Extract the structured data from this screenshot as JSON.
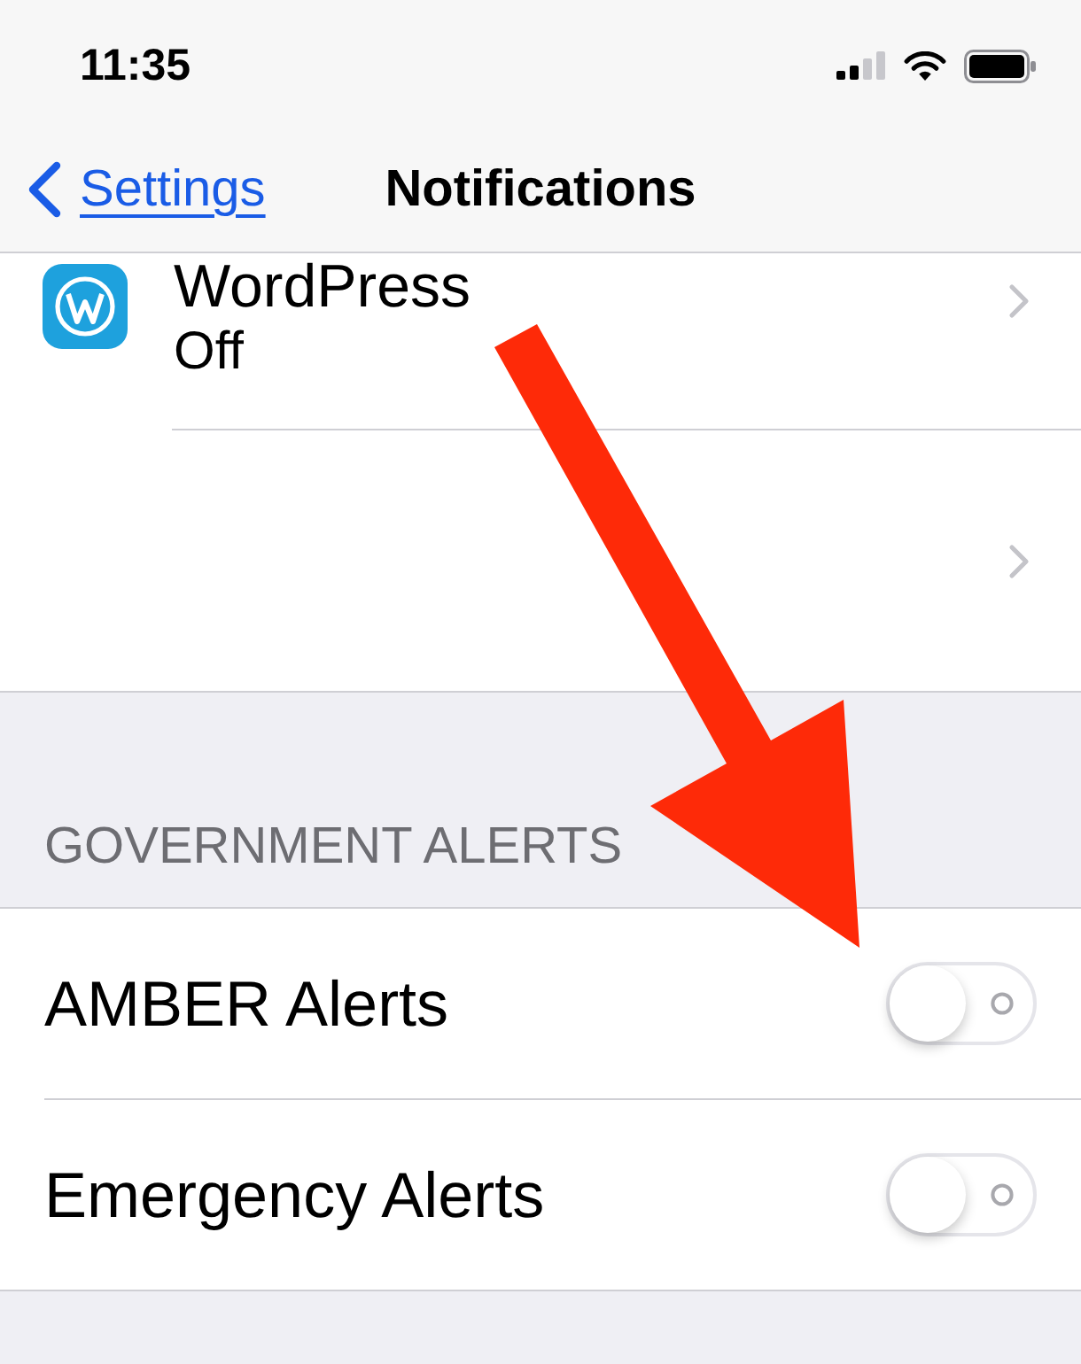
{
  "status_bar": {
    "time": "11:35"
  },
  "nav_bar": {
    "back": "Settings",
    "title": "Notifications"
  },
  "app_rows": [
    {
      "kind": "app",
      "name": "WordPress",
      "subtitle": "Off"
    },
    {
      "kind": "blank"
    }
  ],
  "sections": [
    {
      "header": "GOVERNMENT ALERTS",
      "rows": [
        {
          "label": "AMBER Alerts",
          "on": false
        },
        {
          "label": "Emergency Alerts",
          "on": false
        }
      ]
    }
  ]
}
